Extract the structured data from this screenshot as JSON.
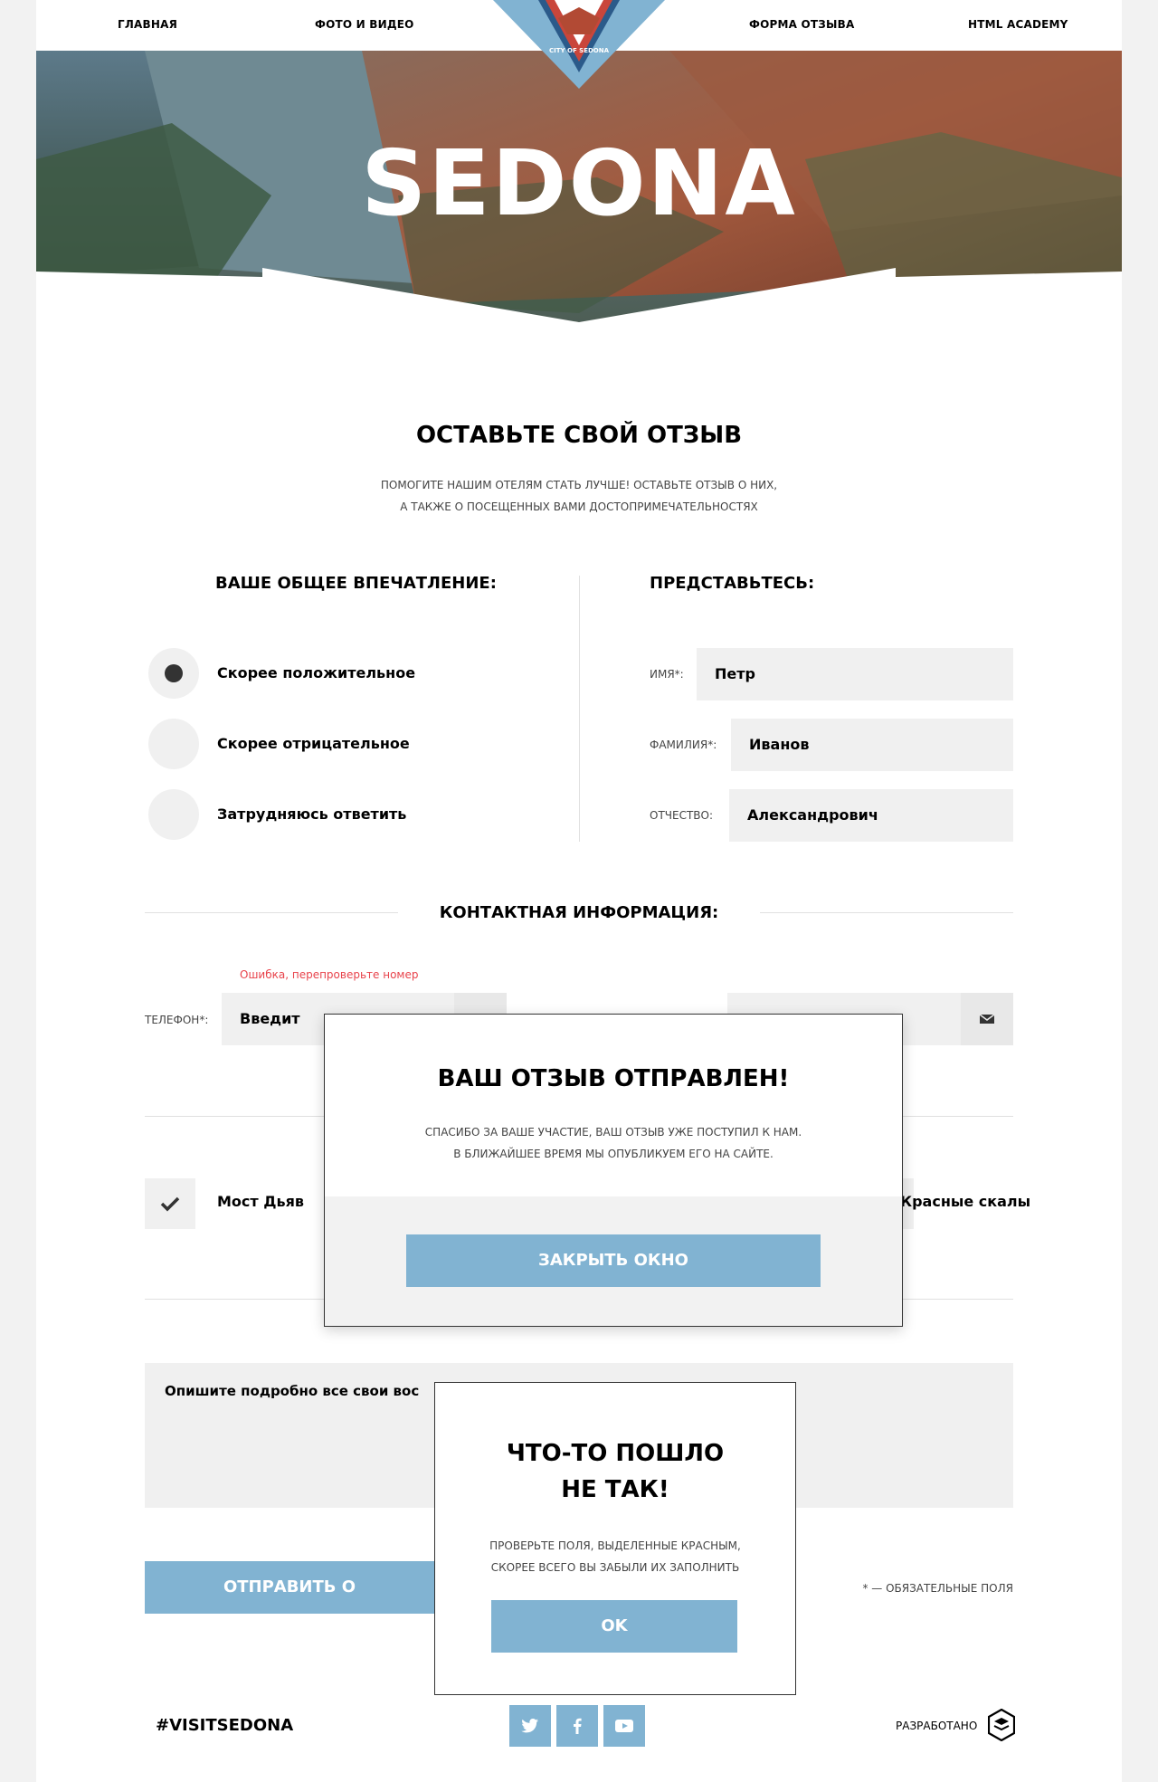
{
  "nav": {
    "items": [
      "Главная",
      "Фото и видео",
      "Форма отзыва",
      "HTML Academy"
    ],
    "logo_text": "CITY OF SEDONA"
  },
  "hero": {
    "title": "SEDONA"
  },
  "form": {
    "title": "Оставьте свой отзыв",
    "subtitle_line1": "Помогите нашим отелям стать лучше! Оставьте отзыв о них,",
    "subtitle_line2": "а также о посещенных вами достопримечательностях",
    "impression": {
      "title": "Ваше общее впечатление:",
      "options": [
        "Скорее положительное",
        "Скорее отрицательное",
        "Затрудняюсь ответить"
      ],
      "selected_index": 0
    },
    "identity": {
      "title": "Представьтесь:",
      "fields": [
        {
          "label": "Имя*:",
          "value": "Петр"
        },
        {
          "label": "Фамилия*:",
          "value": "Иванов"
        },
        {
          "label": "Отчество:",
          "value": "Александрович"
        }
      ]
    },
    "contact": {
      "title": "Контактная информация:",
      "error": "Ошибка, перепроверьте номер",
      "phone_label": "Телефон*:",
      "phone_value": "Введит"
    },
    "places": {
      "checked": "Мост Дьяв",
      "other": "Красные скалы"
    },
    "textarea_text": "Опишите подробно все свои вос",
    "submit": "Отправить о",
    "required_note": "* — обязательные поля"
  },
  "footer": {
    "hashtag": "#VISITSEDONA",
    "social": [
      "twitter-icon",
      "facebook-icon",
      "youtube-icon"
    ],
    "developed": "Разработано"
  },
  "modal_success": {
    "title": "Ваш отзыв отправлен!",
    "text_line1": "Спасибо за ваше участие, ваш отзыв уже поступил к нам.",
    "text_line2": "В ближайшее время мы опубликуем его на сайте.",
    "button": "Закрыть окно"
  },
  "modal_error": {
    "title_line1": "Что-то пошло",
    "title_line2": "не так!",
    "text_line1": "Проверьте поля, выделенные красным,",
    "text_line2": "скорее всего вы забыли их заполнить",
    "button": "OK"
  },
  "colors": {
    "accent": "#81b3d2",
    "error": "#e8434b",
    "field_bg": "#f0f0f0"
  }
}
